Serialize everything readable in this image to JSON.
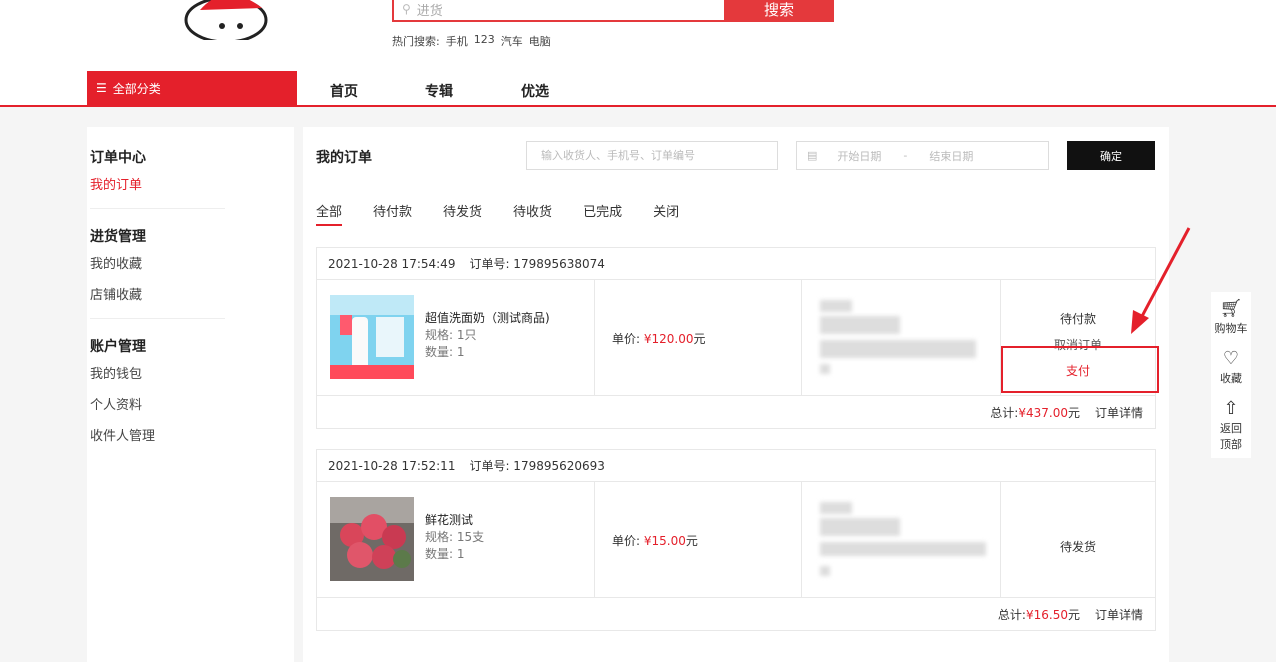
{
  "search": {
    "placeholder": "进货",
    "button": "搜索",
    "hot_label": "热门搜索:",
    "hot_terms": [
      "手机",
      "123",
      "汽车",
      "电脑"
    ]
  },
  "nav": {
    "category": "全部分类",
    "links": [
      "首页",
      "专辑",
      "优选"
    ]
  },
  "sidebar": {
    "groups": [
      {
        "title": "订单中心",
        "items": [
          "我的订单"
        ]
      },
      {
        "title": "进货管理",
        "items": [
          "我的收藏",
          "店铺收藏"
        ]
      },
      {
        "title": "账户管理",
        "items": [
          "我的钱包",
          "个人资料",
          "收件人管理"
        ]
      }
    ]
  },
  "main": {
    "title": "我的订单",
    "search_placeholder": "输入收货人、手机号、订单编号",
    "date_start": "开始日期",
    "date_sep": "-",
    "date_end": "结束日期",
    "confirm": "确定",
    "tabs": [
      "全部",
      "待付款",
      "待发货",
      "待收货",
      "已完成",
      "关闭"
    ]
  },
  "orders": [
    {
      "time": "2021-10-28 17:54:49",
      "order_no": "订单号: 179895638074",
      "product": "超值洗面奶（测试商品)",
      "spec": "规格: 1只",
      "qty": "数量: 1",
      "unit_label": "单价:",
      "unit_price": "¥120.00",
      "unit_suffix": "元",
      "status": "待付款",
      "cancel": "取消订单",
      "pay": "支付",
      "total_label": "总计:",
      "total": "¥437.00",
      "total_suffix": "元",
      "detail": "订单详情"
    },
    {
      "time": "2021-10-28 17:52:11",
      "order_no": "订单号: 179895620693",
      "product": "鲜花测试",
      "spec": "规格: 15支",
      "qty": "数量: 1",
      "unit_label": "单价:",
      "unit_price": "¥15.00",
      "unit_suffix": "元",
      "status": "待发货",
      "total_label": "总计:",
      "total": "¥16.50",
      "total_suffix": "元",
      "detail": "订单详情"
    }
  ],
  "float": {
    "cart": "购物车",
    "fav": "收藏",
    "top_1": "返回",
    "top_2": "顶部"
  },
  "icons": [
    "search-icon",
    "menu-icon",
    "calendar-icon",
    "cart-icon",
    "heart-icon",
    "back-to-top-icon"
  ],
  "colors": {
    "accent": "#e4202b",
    "dark_button": "#111111"
  }
}
